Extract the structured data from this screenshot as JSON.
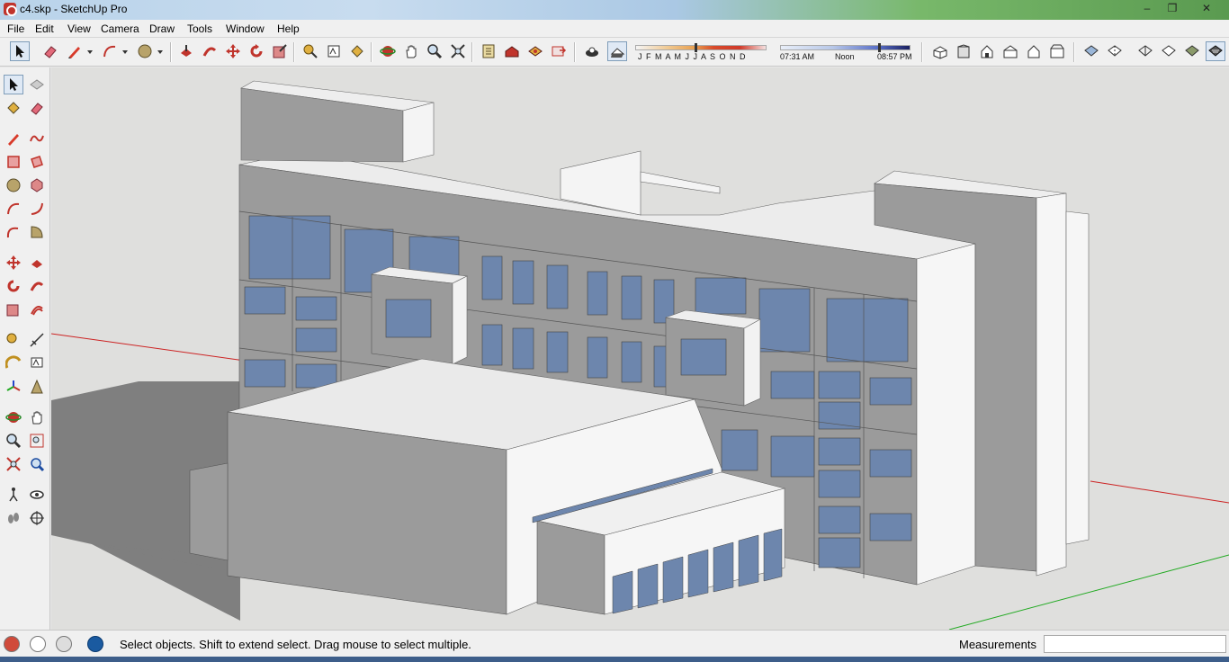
{
  "window": {
    "title": "c4.skp - SketchUp Pro",
    "minimize_glyph": "–",
    "maximize_glyph": "❐",
    "close_glyph": "✕"
  },
  "menu": {
    "items": [
      "File",
      "Edit",
      "View",
      "Camera",
      "Draw",
      "Tools",
      "Window",
      "Help"
    ]
  },
  "shadow_settings": {
    "months": "J F M A M J J A S O N D",
    "time_start": "07:31 AM",
    "time_mid": "Noon",
    "time_end": "08:57 PM"
  },
  "status": {
    "hint": "Select objects. Shift to extend select. Drag mouse to select multiple.",
    "measurements_label": "Measurements",
    "measurements_value": ""
  },
  "colors": {
    "axis_red": "#cc2222",
    "axis_green": "#22aa22",
    "wall_light": "#f2f2f2",
    "wall_shade": "#9b9b9b",
    "glass": "#6d86ad",
    "shadow": "#8a8a8a",
    "background": "#dfdfdd"
  }
}
